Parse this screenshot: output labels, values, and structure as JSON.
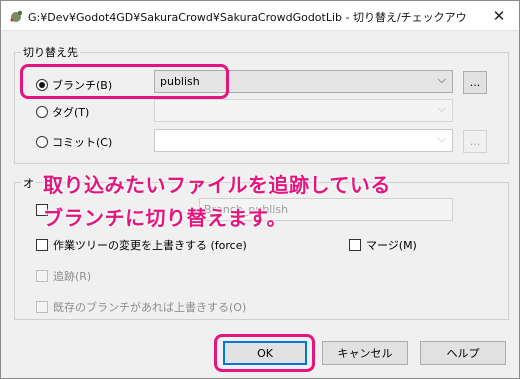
{
  "window": {
    "title": "G:¥Dev¥Godot4GD¥SakuraCrowd¥SakuraCrowdGodotLib - 切り替え/チェックアウト - Tort...",
    "close_icon": "close-icon",
    "app_icon": "tortoisegit-icon"
  },
  "switch_group": {
    "title": "切り替え先",
    "branch_label": "ブランチ(B)",
    "branch_value": "publish",
    "tag_label": "タグ(T)",
    "commit_label": "コミット(C)",
    "browse_label": "..."
  },
  "options_group": {
    "title": "オ",
    "new_branch_placeholder": "Branch_publish",
    "force_label": "作業ツリーの変更を上書きする (force)",
    "merge_label": "マージ(M)",
    "track_label": "追跡(R)",
    "overwrite_branch_label": "既存のブランチがあれば上書きする(O)"
  },
  "overlay": {
    "line1": "取り込みたいファイルを追跡している",
    "line2": "ブランチに切り替えます。",
    "color": "#e5157e"
  },
  "buttons": {
    "ok": "OK",
    "cancel": "キャンセル",
    "help": "ヘルプ"
  }
}
